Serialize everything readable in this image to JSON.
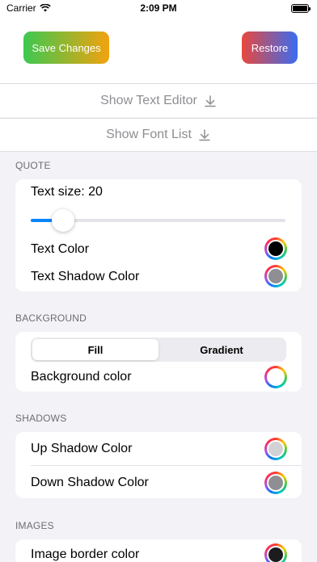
{
  "status_bar": {
    "carrier": "Carrier",
    "time": "2:09 PM"
  },
  "toolbar": {
    "save_label": "Save Changes",
    "restore_label": "Restore"
  },
  "toggles": {
    "text_editor": "Show Text Editor",
    "font_list": "Show Font List"
  },
  "quote": {
    "header": "QUOTE",
    "text_size_label": "Text size: 20",
    "slider_level": 0.09,
    "text_color_label": "Text Color",
    "text_color": "#000000",
    "shadow_color_label": "Text Shadow Color",
    "shadow_color": "#8e8e93"
  },
  "background": {
    "header": "BACKGROUND",
    "segments": [
      "Fill",
      "Gradient"
    ],
    "selected_segment": "Fill",
    "color_label": "Background color",
    "color": "#ffffff"
  },
  "shadows": {
    "header": "SHADOWS",
    "up_label": "Up Shadow Color",
    "up_color": "#d1d1d6",
    "down_label": "Down Shadow Color",
    "down_color": "#8e8e93"
  },
  "images": {
    "header": "IMAGES",
    "border_label": "Image border color",
    "border_color": "#1c1c1e"
  }
}
